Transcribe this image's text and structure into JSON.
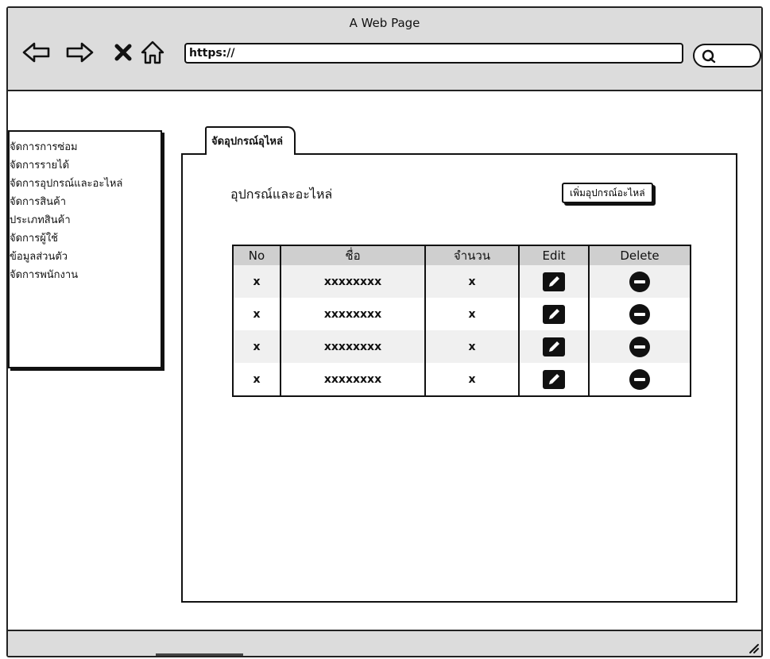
{
  "window": {
    "title": "A Web Page",
    "url": "https://"
  },
  "sidebar": {
    "items": [
      {
        "label": "จัดการการซ่อม"
      },
      {
        "label": "จัดการรายได้"
      },
      {
        "label": "จัดการอุปกรณ์และอะไหล่"
      },
      {
        "label": "จัดการสินค้า"
      },
      {
        "label": "ประเภทสินค้า"
      },
      {
        "label": "จัดการผู้ใช้"
      },
      {
        "label": "ข้อมูลส่วนตัว"
      },
      {
        "label": "จัดการพนักงาน"
      }
    ]
  },
  "main": {
    "tab_label": "จัดอุปกรณ์อุไหล่",
    "panel_title": "อุปกรณ์และอะไหล่",
    "add_button_label": "เพิ่มอุปกรณ์อะไหล่",
    "table": {
      "columns": [
        "No",
        "ชื่อ",
        "จำนวน",
        "Edit",
        "Delete"
      ],
      "rows": [
        {
          "no": "x",
          "name": "xxxxxxxx",
          "qty": "x"
        },
        {
          "no": "x",
          "name": "xxxxxxxx",
          "qty": "x"
        },
        {
          "no": "x",
          "name": "xxxxxxxx",
          "qty": "x"
        },
        {
          "no": "x",
          "name": "xxxxxxxx",
          "qty": "x"
        }
      ]
    }
  },
  "icons": {
    "back": "arrow-left-icon",
    "forward": "arrow-right-icon",
    "stop": "close-icon",
    "home": "home-icon",
    "search": "search-icon",
    "edit": "pencil-icon",
    "delete": "minus-circle-icon"
  }
}
